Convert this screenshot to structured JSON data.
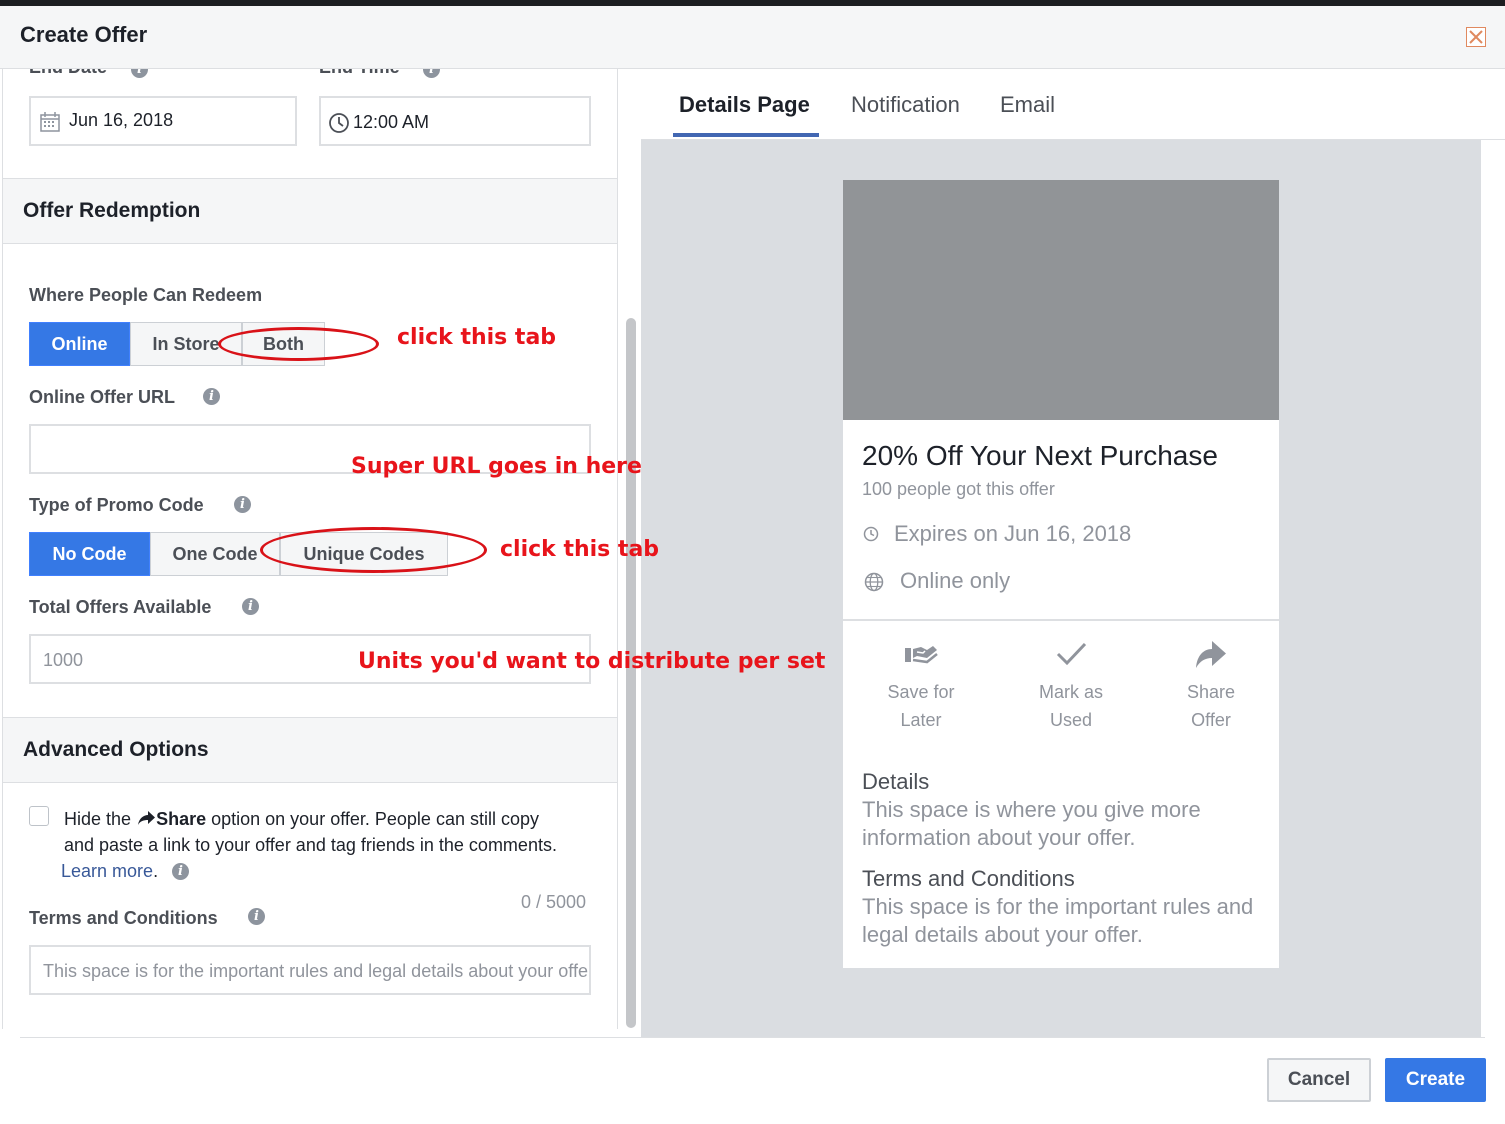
{
  "dialog": {
    "title": "Create Offer"
  },
  "form": {
    "end_date_label": "End Date",
    "end_time_label": "End Time",
    "end_date_value": "Jun 16, 2018",
    "end_time_value": "12:00 AM",
    "offer_redemption_title": "Offer Redemption",
    "where_redeem_label": "Where People Can Redeem",
    "where_redeem_options": [
      "Online",
      "In Store",
      "Both"
    ],
    "where_redeem_selected": "Online",
    "online_url_label": "Online Offer URL",
    "online_url_value": "",
    "promo_code_label": "Type of Promo Code",
    "promo_code_options": [
      "No Code",
      "One Code",
      "Unique Codes"
    ],
    "promo_code_selected": "No Code",
    "total_offers_label": "Total Offers Available",
    "total_offers_placeholder": "1000",
    "advanced_title": "Advanced Options",
    "hide_share_prefix": "Hide the",
    "hide_share_bold": "Share",
    "hide_share_line1_rest": "option on your offer. People can still copy",
    "hide_share_line2": "and paste a link to your offer and tag friends in the comments.",
    "learn_more": "Learn more",
    "char_count": "0 / 5000",
    "terms_label": "Terms and Conditions",
    "terms_placeholder": "This space is for the important rules and legal details about your offer."
  },
  "preview": {
    "tabs": [
      "Details Page",
      "Notification",
      "Email"
    ],
    "active_tab": "Details Page",
    "offer_title": "20% Off Your Next Purchase",
    "offer_sub": "100 people got this offer",
    "expires": "Expires on Jun 16, 2018",
    "location": "Online only",
    "actions": [
      {
        "line1": "Save for",
        "line2": "Later",
        "icon": "save-for-later-icon"
      },
      {
        "line1": "Mark as",
        "line2": "Used",
        "icon": "checkmark-icon"
      },
      {
        "line1": "Share",
        "line2": "Offer",
        "icon": "share-arrow-icon"
      }
    ],
    "details_head": "Details",
    "details_line1": "This space is where you give more",
    "details_line2": "information about your offer.",
    "terms_head": "Terms and Conditions",
    "terms_line1": "This space is for the important rules and",
    "terms_line2": "legal details about your offer."
  },
  "footer": {
    "cancel": "Cancel",
    "create": "Create"
  },
  "annotations": {
    "click_both": "click this tab",
    "super_url": "Super URL goes in here",
    "click_unique": "click this tab",
    "units": "Units you'd want to distribute per set"
  },
  "colors": {
    "accent": "#3578e5",
    "annotation": "#e8141b",
    "tab_underline": "#4267b2"
  }
}
